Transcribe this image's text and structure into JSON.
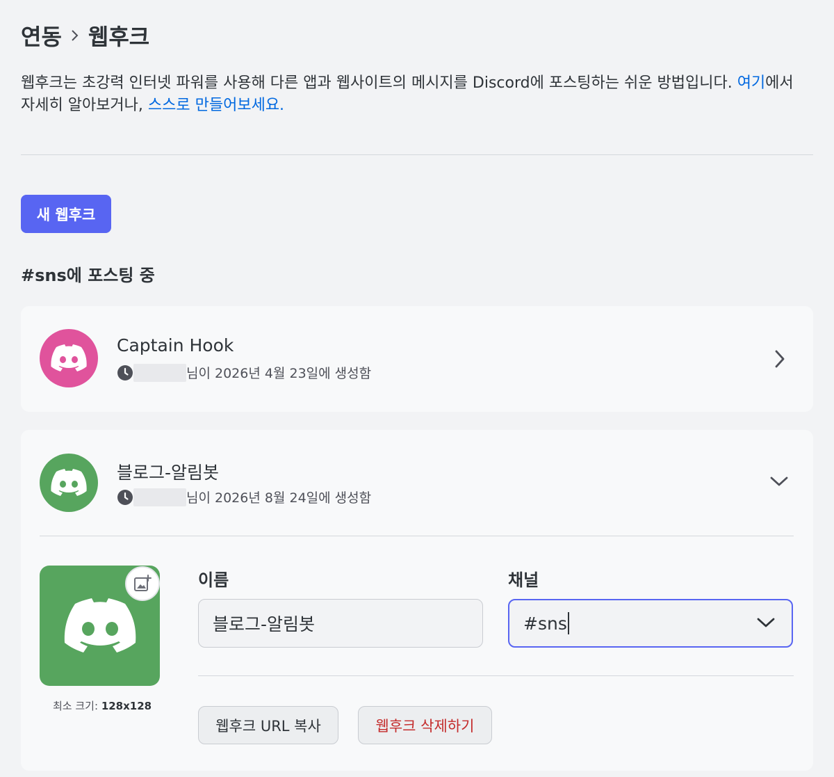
{
  "breadcrumb": {
    "parent": "연동",
    "current": "웹후크"
  },
  "description": {
    "text_before_link1": "웹후크는 초강력 인터넷 파워를 사용해 다른 앱과 웹사이트의 메시지를 Discord에 포스팅하는 쉬운 방법입니다. ",
    "link1": "여기",
    "text_after_link1": "에서 자세히 알아보거나, ",
    "link2": "스스로 만들어보세요."
  },
  "new_webhook_button": "새 웹후크",
  "posting_title": "#sns에 포스팅 중",
  "webhooks": [
    {
      "name": "Captain Hook",
      "meta_suffix": "님이 2026년 4월 23일에 생성함",
      "avatar_color": "#e0539c",
      "icon": "chevron-right-icon"
    },
    {
      "name": "블로그-알림봇",
      "meta_suffix": "님이 2026년 8월 24일에 생성함",
      "avatar_color": "#57a55e",
      "icon": "chevron-down-icon"
    }
  ],
  "editor": {
    "min_size_label": "최소 크기:",
    "min_size_value": "128x128",
    "name_label": "이름",
    "name_value": "블로그-알림봇",
    "channel_label": "채널",
    "channel_value": "#sns",
    "copy_url_button": "웹후크 URL 복사",
    "delete_button": "웹후크 삭제하기"
  },
  "colors": {
    "accent": "#5865f2",
    "link": "#0068e0",
    "danger": "#c42b2b"
  }
}
